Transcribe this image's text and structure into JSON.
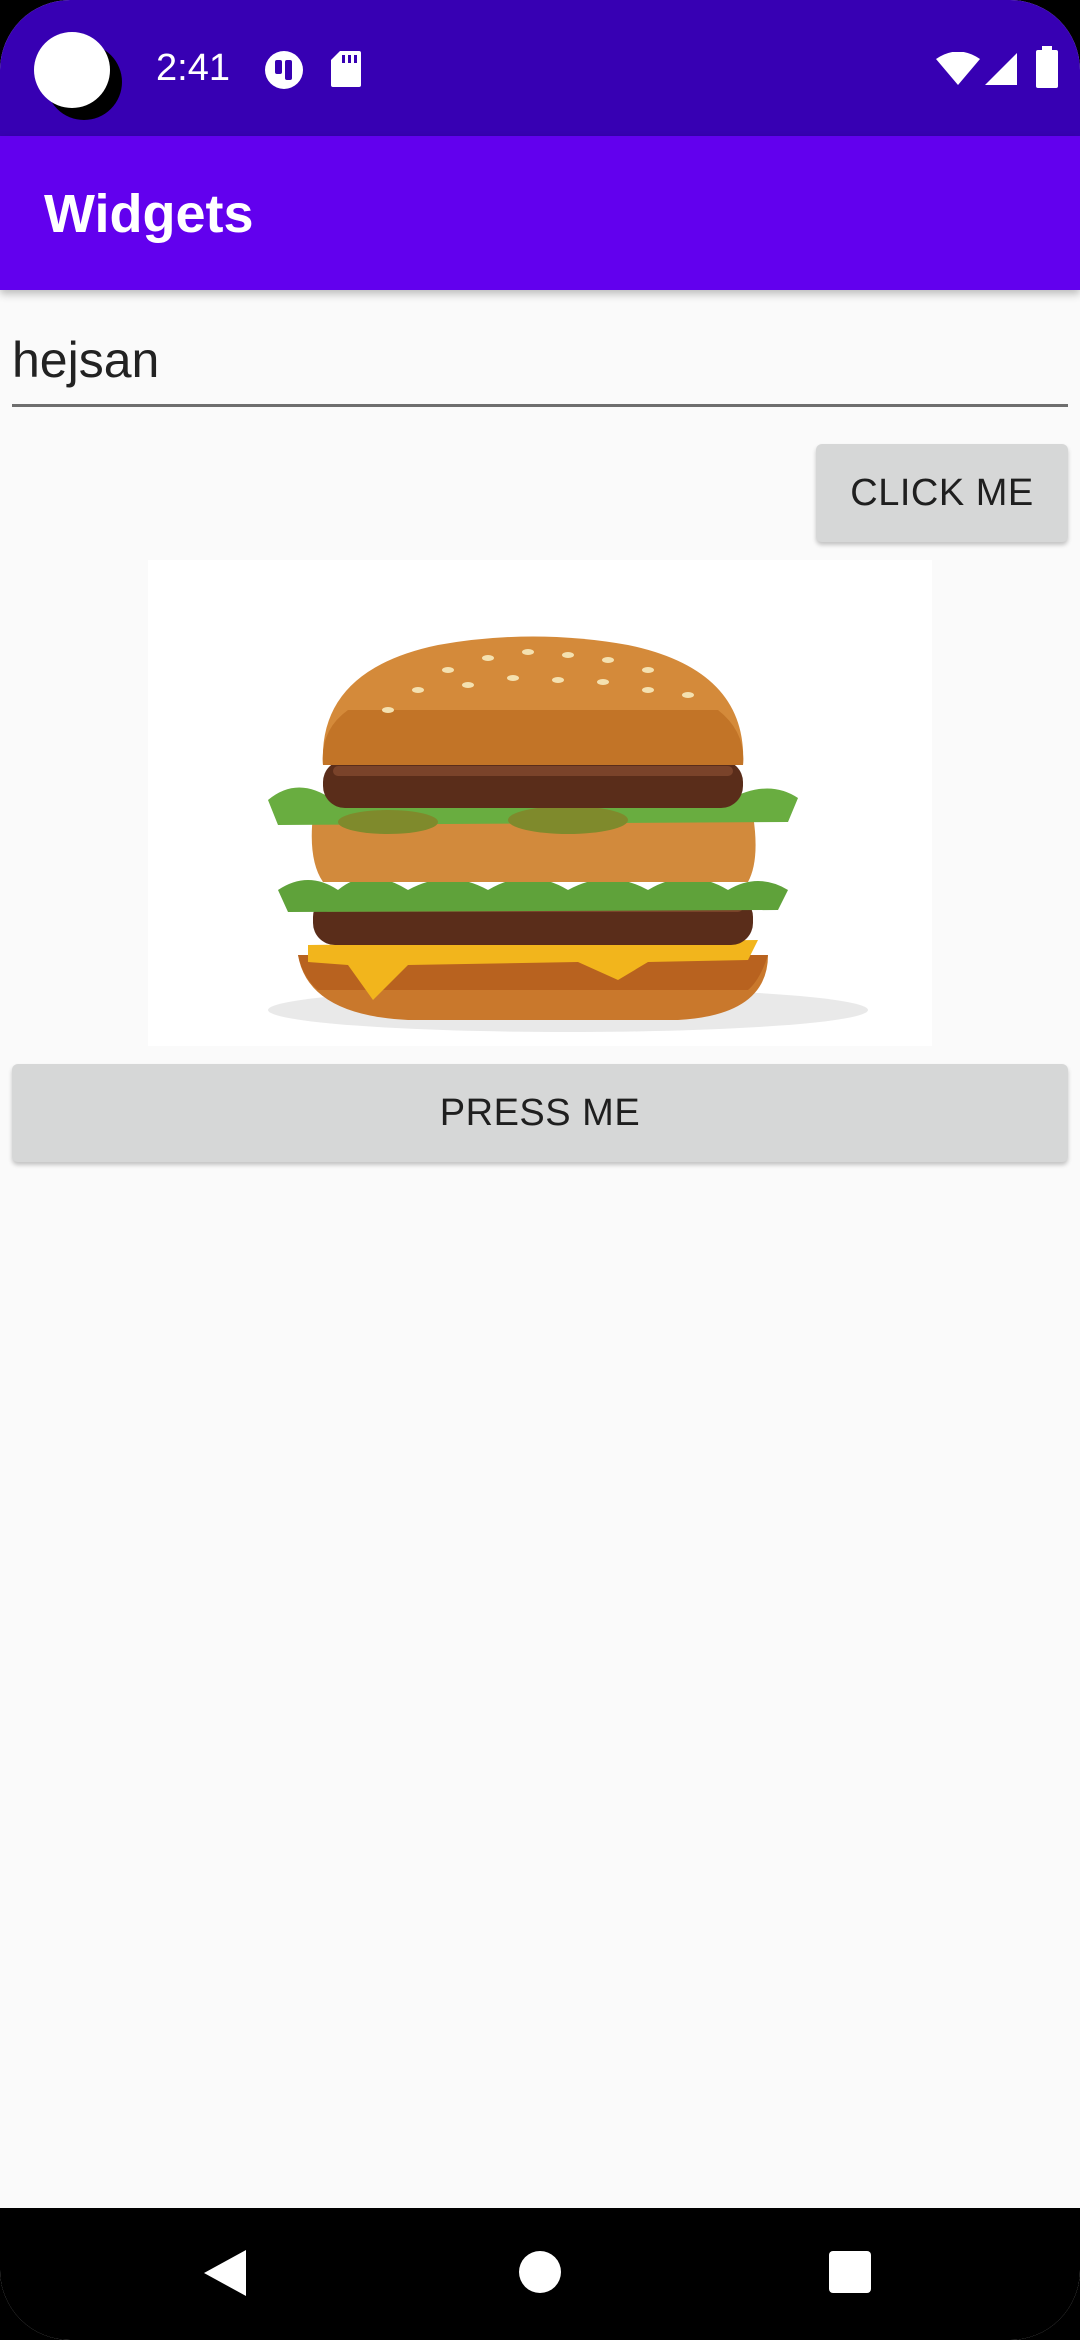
{
  "status_bar": {
    "time": "2:41",
    "icons": [
      "camera-cutout",
      "notification-app-icon",
      "sd-card-icon",
      "wifi-icon",
      "signal-icon",
      "battery-icon"
    ],
    "background_color": "#3700b3"
  },
  "app_bar": {
    "title": "Widgets",
    "background_color": "#6200ee"
  },
  "form": {
    "text_field_value": "hejsan",
    "click_button_label": "CLICK ME",
    "press_button_label": "PRESS ME"
  },
  "image": {
    "subject": "burger-image"
  },
  "nav_bar": {
    "icons": [
      "back-icon",
      "home-icon",
      "recents-icon"
    ]
  }
}
